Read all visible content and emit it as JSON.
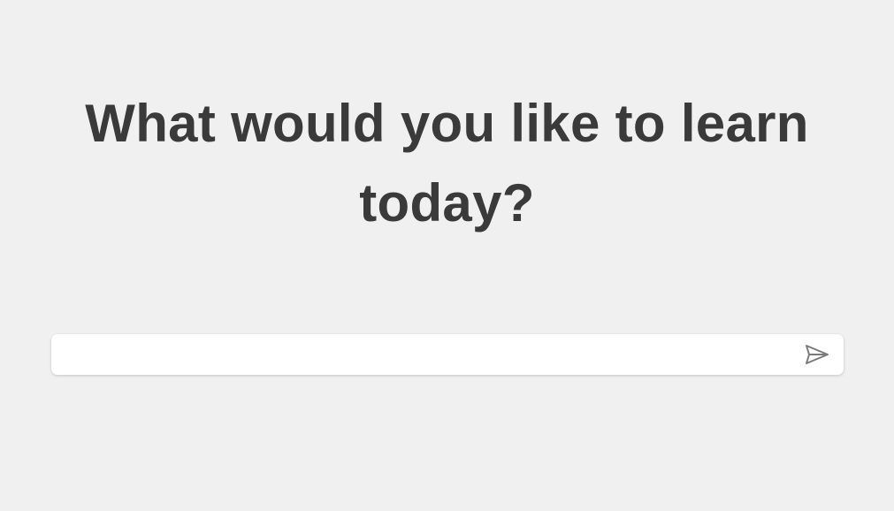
{
  "headline": "What would you like to learn today?",
  "search": {
    "value": "",
    "placeholder": ""
  },
  "send_button": {
    "icon": "send-icon",
    "icon_color": "#7a7a7a"
  },
  "colors": {
    "background": "#f0f0f0",
    "headline": "#3a3a3a",
    "input_background": "#ffffff"
  }
}
